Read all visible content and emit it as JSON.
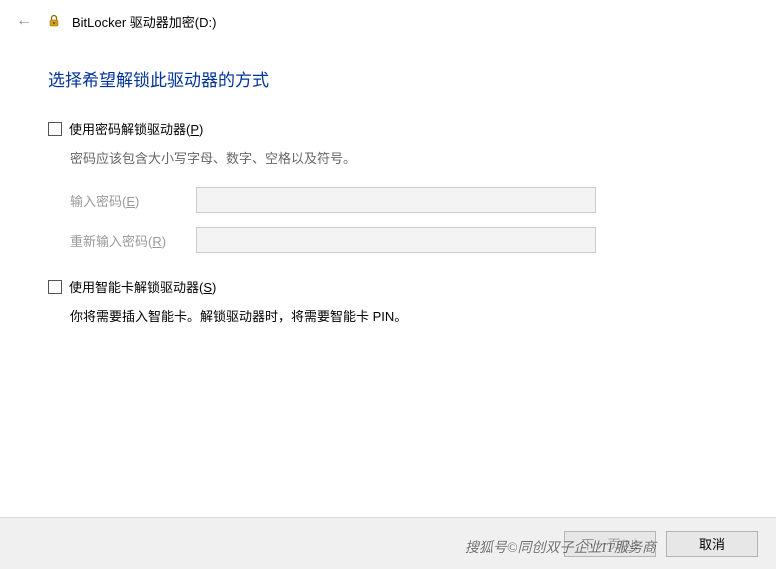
{
  "titlebar": {
    "title": "BitLocker 驱动器加密(D:)"
  },
  "content": {
    "heading": "选择希望解锁此驱动器的方式",
    "password_option": {
      "label_prefix": "使用密码解锁驱动器(",
      "label_hotkey": "P",
      "label_suffix": ")",
      "description": "密码应该包含大小写字母、数字、空格以及符号。",
      "field1_label_prefix": "输入密码(",
      "field1_hotkey": "E",
      "field1_label_suffix": ")",
      "field2_label_prefix": "重新输入密码(",
      "field2_hotkey": "R",
      "field2_label_suffix": ")"
    },
    "smartcard_option": {
      "label_prefix": "使用智能卡解锁驱动器(",
      "label_hotkey": "S",
      "label_suffix": ")",
      "description": "你将需要插入智能卡。解锁驱动器时，将需要智能卡 PIN。"
    }
  },
  "footer": {
    "next_prefix": "下一页(",
    "next_hotkey": "N",
    "next_suffix": ")",
    "cancel": "取消"
  },
  "watermark": "搜狐号©同创双子企业IT服务商"
}
